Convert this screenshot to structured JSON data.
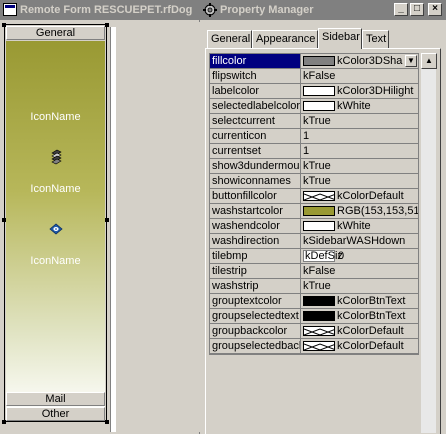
{
  "left_window": {
    "title": "Remote Form RESCUEPET.rfDog"
  },
  "sidebar": {
    "groups_top": [
      "General"
    ],
    "groups_bottom": [
      "Mail",
      "Other"
    ],
    "icons": [
      {
        "label": "IconName",
        "icon": "none"
      },
      {
        "label": "IconName",
        "icon": "stack-icon"
      },
      {
        "label": "IconName",
        "icon": "disk-icon"
      }
    ],
    "wash_colors": {
      "start": "#999933",
      "end": "#ffffff"
    }
  },
  "property_manager": {
    "title": "Property Manager",
    "caption_buttons": [
      "_",
      "□",
      "×"
    ],
    "tabs": [
      "General",
      "Appearance",
      "Sidebar",
      "Text"
    ],
    "active_tab": "Sidebar",
    "properties": [
      {
        "name": "fillcolor",
        "value": "kColor3DSha",
        "swatch": "#808080",
        "selected": true
      },
      {
        "name": "flipswitch",
        "value": "kFalse"
      },
      {
        "name": "labelcolor",
        "value": "kColor3DHilight",
        "swatch": "#ffffff"
      },
      {
        "name": "selectedlabelcolor",
        "value": "kWhite",
        "swatch": "#ffffff"
      },
      {
        "name": "selectcurrent",
        "value": "kTrue"
      },
      {
        "name": "currenticon",
        "value": "1"
      },
      {
        "name": "currentset",
        "value": "1"
      },
      {
        "name": "show3dundermous",
        "value": "kTrue"
      },
      {
        "name": "showiconnames",
        "value": "kTrue"
      },
      {
        "name": "buttonfillcolor",
        "value": "kColorDefault",
        "pattern": true
      },
      {
        "name": "washstartcolor",
        "value": "RGB(153,153,51",
        "swatch": "#999933"
      },
      {
        "name": "washendcolor",
        "value": "kWhite",
        "swatch": "#ffffff"
      },
      {
        "name": "washdirection",
        "value": "kSidebarWASHdown"
      },
      {
        "name": "tilebmp",
        "value": "0",
        "box": "kDefSiz"
      },
      {
        "name": "tilestrip",
        "value": "kFalse"
      },
      {
        "name": "washstrip",
        "value": "kTrue"
      },
      {
        "name": "grouptextcolor",
        "value": "kColorBtnText",
        "swatch": "#000000"
      },
      {
        "name": "groupselectedtext",
        "value": "kColorBtnText",
        "swatch": "#000000"
      },
      {
        "name": "groupbackcolor",
        "value": "kColorDefault",
        "pattern": true
      },
      {
        "name": "groupselectedbacl",
        "value": "kColorDefault",
        "pattern": true
      }
    ]
  }
}
